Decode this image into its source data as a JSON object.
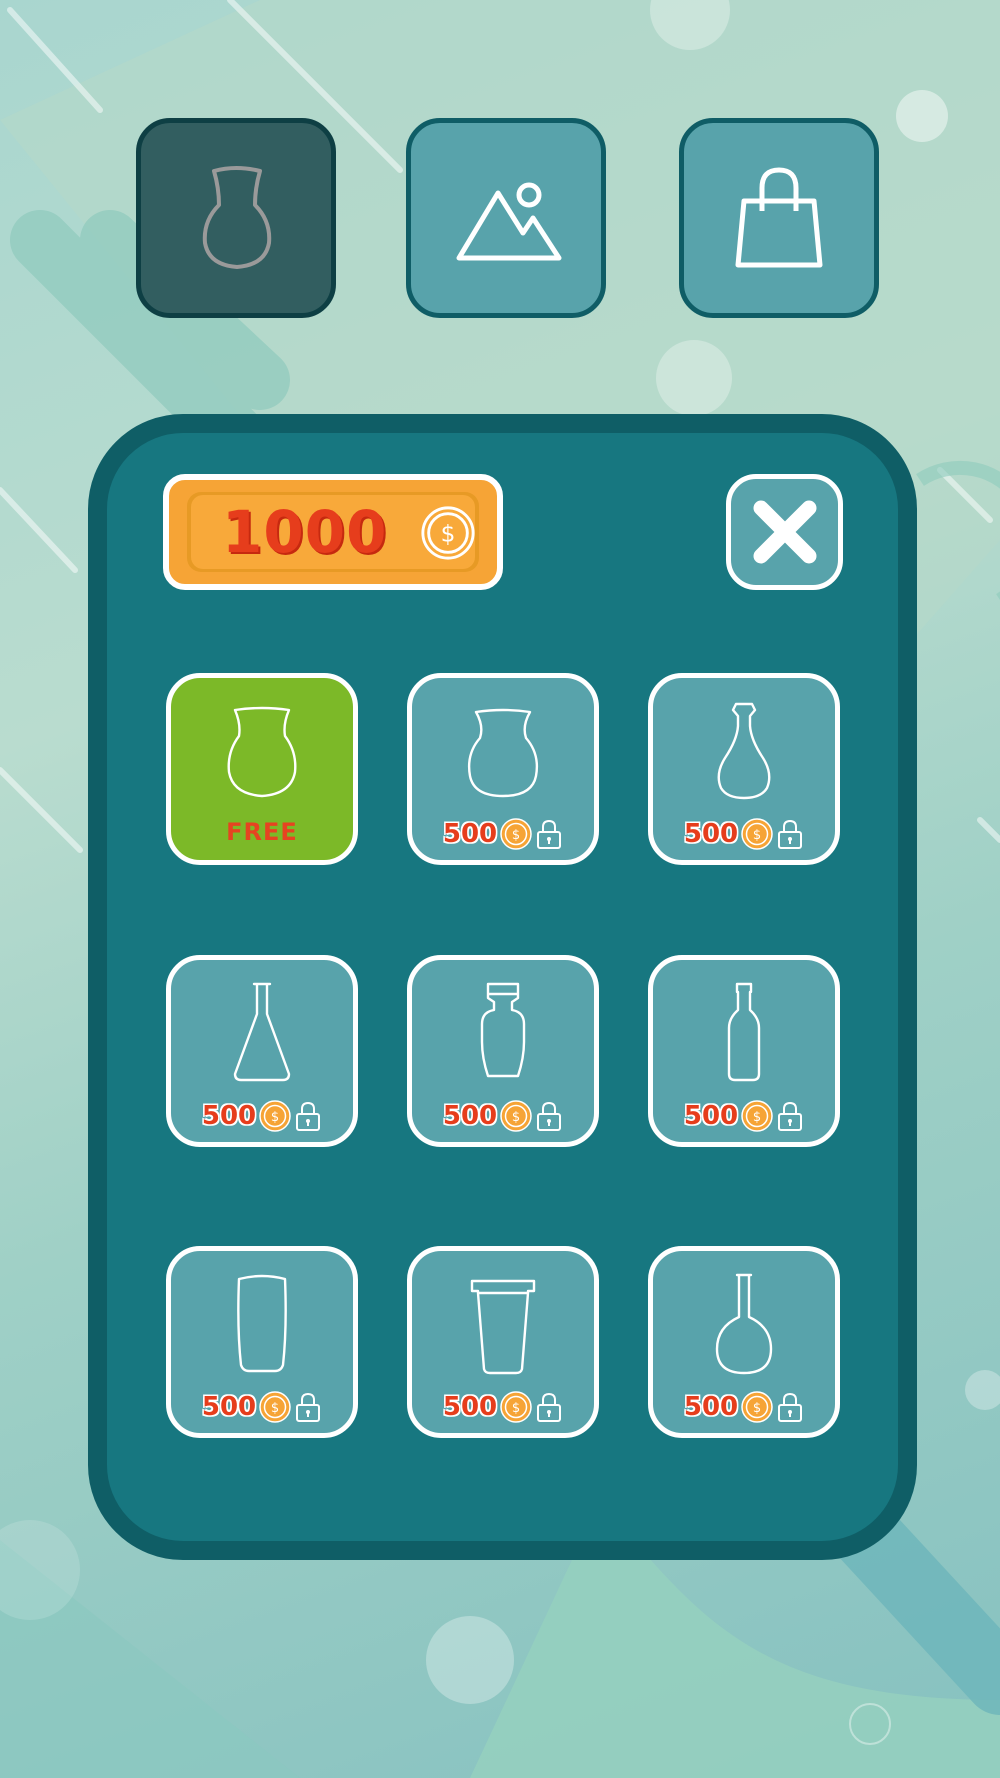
{
  "tabs": [
    {
      "name": "glasses",
      "icon": "glass-icon",
      "active": true
    },
    {
      "name": "backgrounds",
      "icon": "mountain-image-icon",
      "active": false
    },
    {
      "name": "shop",
      "icon": "shopping-bag-icon",
      "active": false
    }
  ],
  "wallet": {
    "balance": "1000",
    "icon": "coin-icon"
  },
  "close_icon": "close-icon",
  "items": [
    {
      "shape": "tulip-glass",
      "label": "FREE",
      "locked": false
    },
    {
      "shape": "round-vase",
      "price": "500",
      "locked": true
    },
    {
      "shape": "carafe",
      "price": "500",
      "locked": true
    },
    {
      "shape": "conical-flask",
      "price": "500",
      "locked": true
    },
    {
      "shape": "decanter",
      "price": "500",
      "locked": true
    },
    {
      "shape": "bottle",
      "price": "500",
      "locked": true
    },
    {
      "shape": "tall-tumbler",
      "price": "500",
      "locked": true
    },
    {
      "shape": "lidded-cup",
      "price": "500",
      "locked": true
    },
    {
      "shape": "round-flask",
      "price": "500",
      "locked": true
    }
  ],
  "colors": {
    "panel": "#177780",
    "panel_border": "#0f5e66",
    "tile": "#58a3ab",
    "free_tile": "#7cb928",
    "price_text": "#e63d1c",
    "coin": "#f6a436"
  }
}
